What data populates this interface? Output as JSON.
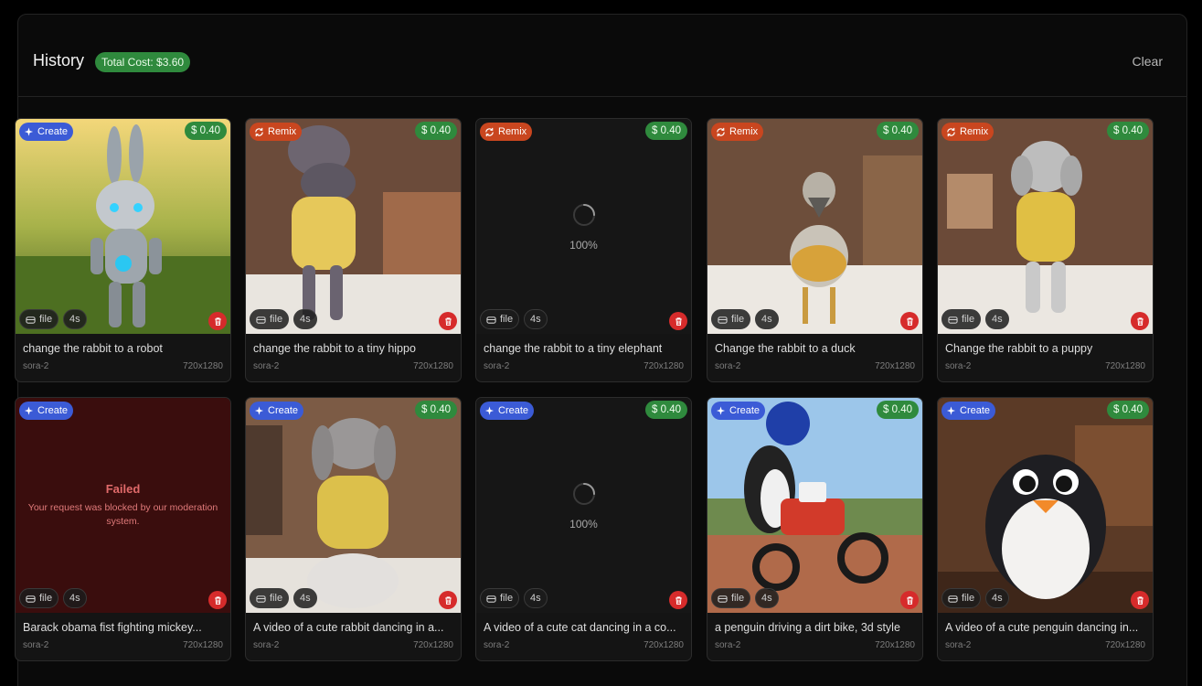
{
  "header": {
    "title": "History",
    "total_cost": "Total Cost: $3.60",
    "clear_label": "Clear"
  },
  "colors": {
    "create_badge": "#3b5bd6",
    "remix_badge": "#c9461f",
    "cost_badge": "#2f8a3d",
    "delete_button": "#d62b2b",
    "failed_background": "#3a0d0d"
  },
  "cards": [
    {
      "type_label": "Create",
      "type": "create",
      "cost": "$ 0.40",
      "file_label": "file",
      "duration": "4s",
      "prompt": "change the rabbit to a robot",
      "model": "sora-2",
      "resolution": "720x1280",
      "state": "done",
      "thumbnail": "robot-rabbit"
    },
    {
      "type_label": "Remix",
      "type": "remix",
      "cost": "$ 0.40",
      "file_label": "file",
      "duration": "4s",
      "prompt": "change the rabbit to a tiny hippo",
      "model": "sora-2",
      "resolution": "720x1280",
      "state": "done",
      "thumbnail": "hippo-sweater"
    },
    {
      "type_label": "Remix",
      "type": "remix",
      "cost": "$ 0.40",
      "file_label": "file",
      "duration": "4s",
      "prompt": "change the rabbit to a tiny elephant",
      "model": "sora-2",
      "resolution": "720x1280",
      "state": "loading",
      "progress": "100%"
    },
    {
      "type_label": "Remix",
      "type": "remix",
      "cost": "$ 0.40",
      "file_label": "file",
      "duration": "4s",
      "prompt": "Change the rabbit to a duck",
      "model": "sora-2",
      "resolution": "720x1280",
      "state": "done",
      "thumbnail": "duck-sweater"
    },
    {
      "type_label": "Remix",
      "type": "remix",
      "cost": "$ 0.40",
      "file_label": "file",
      "duration": "4s",
      "prompt": "Change the rabbit to a puppy",
      "model": "sora-2",
      "resolution": "720x1280",
      "state": "done",
      "thumbnail": "puppy-sweater"
    },
    {
      "type_label": "Create",
      "type": "create",
      "cost": "",
      "file_label": "file",
      "duration": "4s",
      "prompt": "Barack obama fist fighting mickey...",
      "model": "sora-2",
      "resolution": "720x1280",
      "state": "failed",
      "fail_title": "Failed",
      "fail_message": "Your request was blocked by our moderation system."
    },
    {
      "type_label": "Create",
      "type": "create",
      "cost": "$ 0.40",
      "file_label": "file",
      "duration": "4s",
      "prompt": "A video of a cute rabbit dancing in a...",
      "model": "sora-2",
      "resolution": "720x1280",
      "state": "done",
      "thumbnail": "rabbit-sweater"
    },
    {
      "type_label": "Create",
      "type": "create",
      "cost": "$ 0.40",
      "file_label": "file",
      "duration": "4s",
      "prompt": "A video of a cute cat dancing in a co...",
      "model": "sora-2",
      "resolution": "720x1280",
      "state": "loading",
      "progress": "100%"
    },
    {
      "type_label": "Create",
      "type": "create",
      "cost": "$ 0.40",
      "file_label": "file",
      "duration": "4s",
      "prompt": "a penguin driving a dirt bike, 3d style",
      "model": "sora-2",
      "resolution": "720x1280",
      "state": "done",
      "thumbnail": "penguin-dirtbike"
    },
    {
      "type_label": "Create",
      "type": "create",
      "cost": "$ 0.40",
      "file_label": "file",
      "duration": "4s",
      "prompt": "A video of a cute penguin dancing in...",
      "model": "sora-2",
      "resolution": "720x1280",
      "state": "done",
      "thumbnail": "penguin-cabin"
    }
  ]
}
